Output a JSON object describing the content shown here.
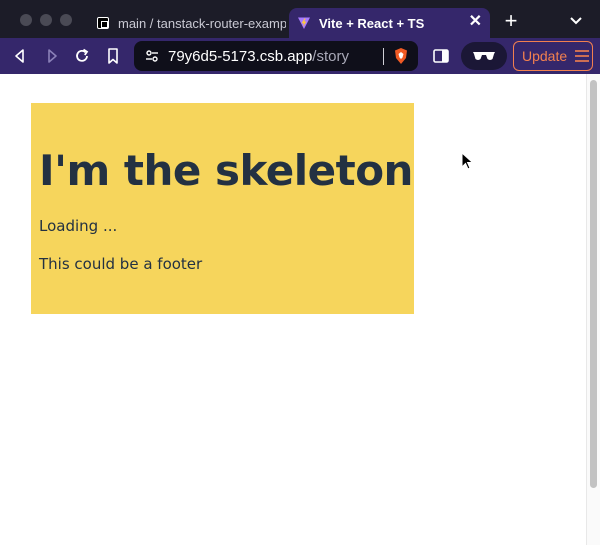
{
  "browser": {
    "tabs": [
      {
        "label": "main / tanstack-router-example",
        "active": false,
        "favicon": "codesandbox-icon"
      },
      {
        "label": "Vite + React + TS",
        "active": true,
        "favicon": "vite-icon"
      }
    ],
    "close_tab_glyph": "✕",
    "new_tab_glyph": "+",
    "url": {
      "host": "79y6d5-5173.csb.app",
      "path": "/story"
    },
    "update_label": "Update",
    "accent_color": "#35276b",
    "update_color": "#f2804f"
  },
  "page": {
    "skeleton": {
      "title": "I'm the skeleton",
      "loading": "Loading ...",
      "footer": "This could be a footer",
      "background": "#f6d55c"
    }
  }
}
